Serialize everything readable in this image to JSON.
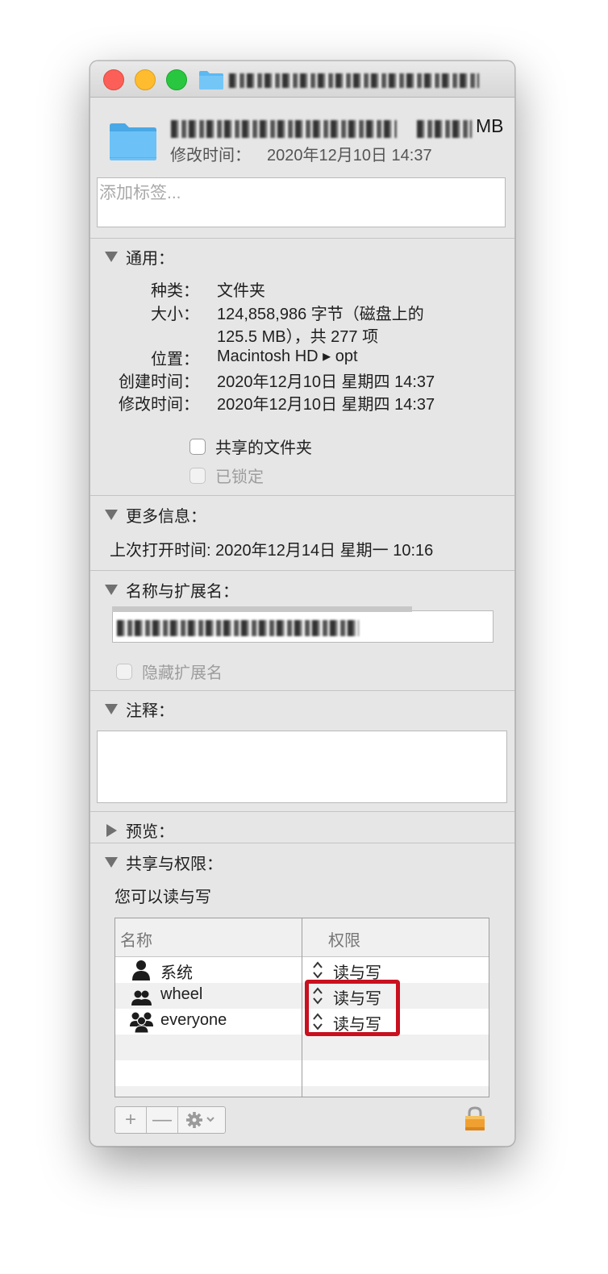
{
  "window": {
    "title_redacted": true
  },
  "header": {
    "size_suffix": "MB",
    "modified_label": "修改时间：",
    "modified_value": "2020年12月10日 14:37",
    "tags_placeholder": "添加标签..."
  },
  "general": {
    "title": "通用：",
    "rows": [
      {
        "label": "种类：",
        "value": "文件夹"
      },
      {
        "label": "大小：",
        "value": "124,858,986 字节（磁盘上的"
      },
      {
        "label": "",
        "value": "125.5 MB），共 277 项"
      },
      {
        "label": "位置：",
        "value": "Macintosh HD ▸ opt"
      },
      {
        "label": "创建时间：",
        "value": "2020年12月10日 星期四 14:37"
      },
      {
        "label": "修改时间：",
        "value": "2020年12月10日 星期四 14:37"
      }
    ],
    "shared_folder": "共享的文件夹",
    "locked": "已锁定"
  },
  "more_info": {
    "title": "更多信息：",
    "last_opened": "上次打开时间: 2020年12月14日 星期一 10:16"
  },
  "name_extension": {
    "title": "名称与扩展名：",
    "hide_extension": "隐藏扩展名"
  },
  "comments": {
    "title": "注释："
  },
  "preview": {
    "title": "预览："
  },
  "sharing": {
    "title": "共享与权限：",
    "summary": "您可以读与写",
    "col_name": "名称",
    "col_privilege": "权限",
    "rows": [
      {
        "name": "系统",
        "privilege": "读与写",
        "icon": "single-user-icon"
      },
      {
        "name": "wheel",
        "privilege": "读与写",
        "icon": "group-icon"
      },
      {
        "name": "everyone",
        "privilege": "读与写",
        "icon": "everyone-icon"
      }
    ],
    "add_symbol": "+",
    "remove_symbol": "—"
  },
  "colors": {
    "highlight": "#c8101f",
    "folder_blue": "#5bb8f2"
  }
}
